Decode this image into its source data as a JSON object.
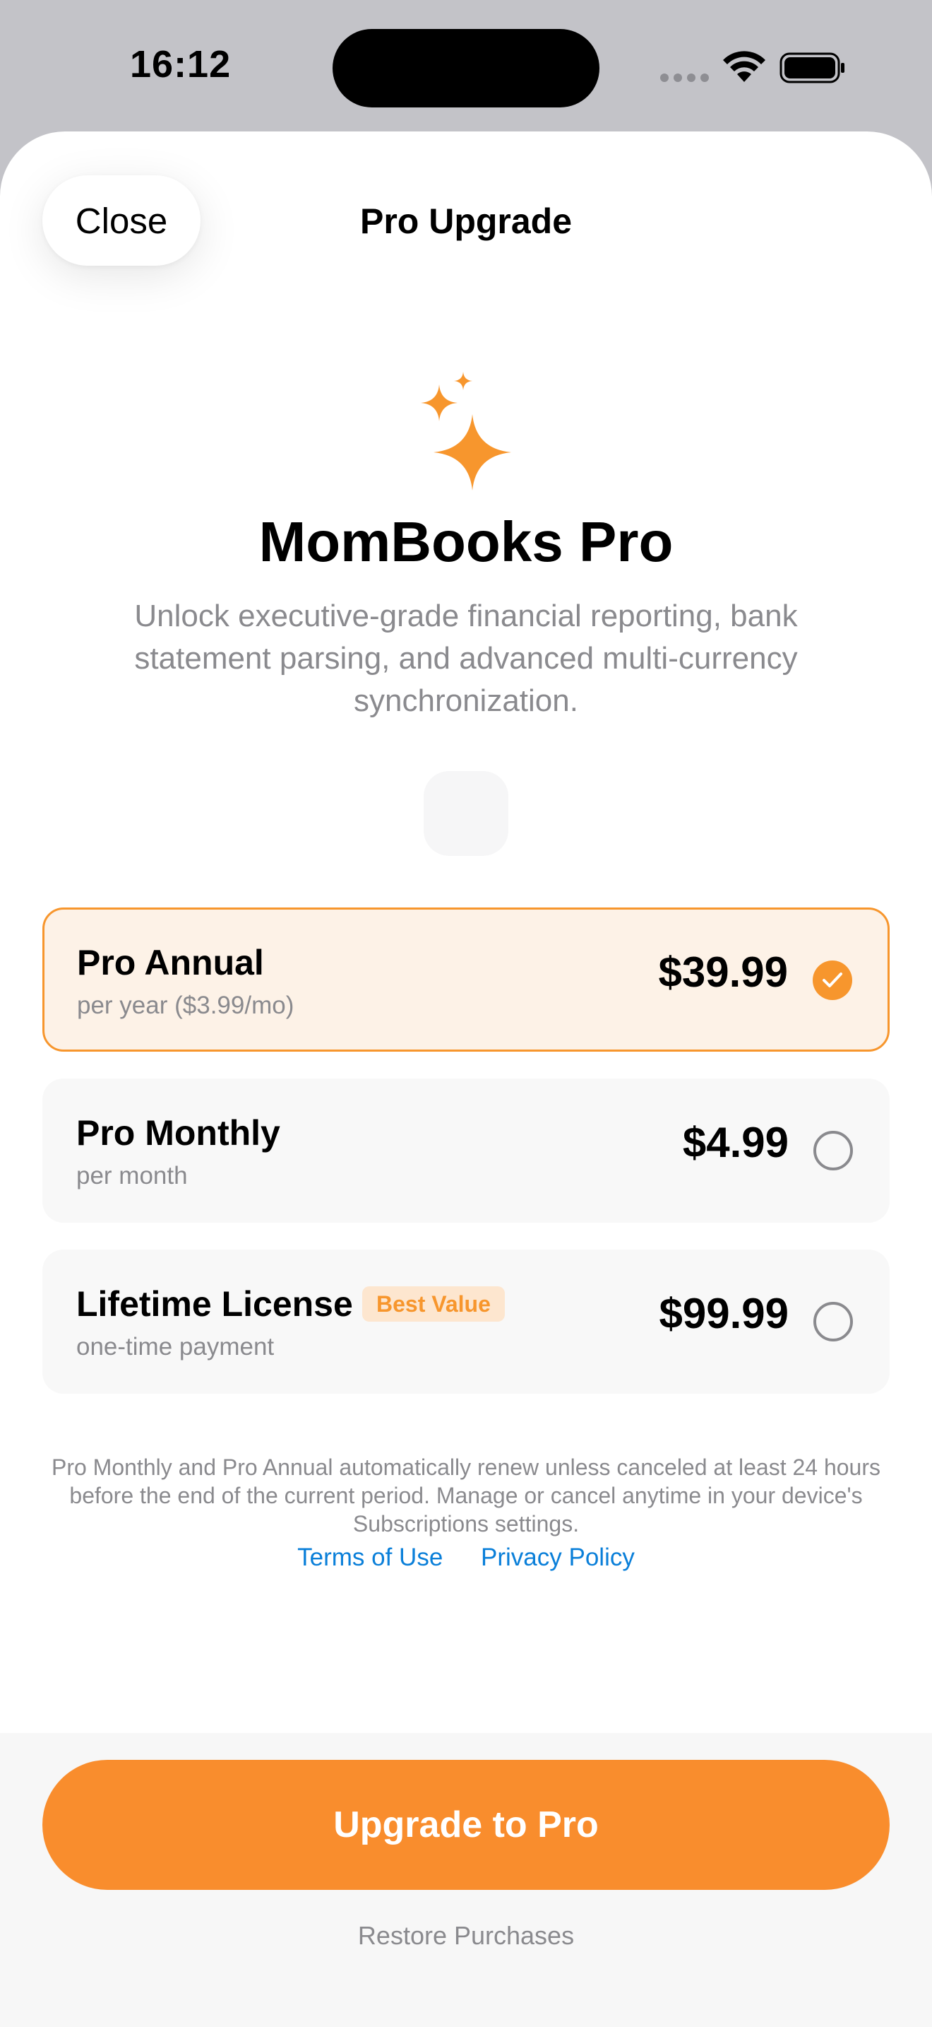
{
  "status_bar": {
    "time": "16:12"
  },
  "nav": {
    "close_label": "Close",
    "title": "Pro Upgrade"
  },
  "hero": {
    "icon": "sparkles-icon",
    "title": "MomBooks Pro",
    "subtitle": "Unlock executive-grade financial reporting, bank statement parsing, and advanced multi-currency synchronization."
  },
  "plans": [
    {
      "name": "Pro Annual",
      "subtitle": "per year ($3.99/mo)",
      "price": "$39.99",
      "selected": true
    },
    {
      "name": "Pro Monthly",
      "subtitle": "per month",
      "price": "$4.99",
      "selected": false
    },
    {
      "name": "Lifetime License",
      "badge": "Best Value",
      "subtitle": "one-time payment",
      "price": "$99.99",
      "selected": false
    }
  ],
  "legal": {
    "text": "Pro Monthly and Pro Annual automatically renew unless canceled at least 24 hours before the end of the current period. Manage or cancel anytime in your device's Subscriptions settings.",
    "terms_label": "Terms of Use",
    "privacy_label": "Privacy Policy"
  },
  "footer": {
    "cta_label": "Upgrade to Pro",
    "restore_label": "Restore Purchases"
  },
  "colors": {
    "accent": "#f7962d",
    "link": "#0a7fd9",
    "secondary_text": "#8a8a8e"
  }
}
